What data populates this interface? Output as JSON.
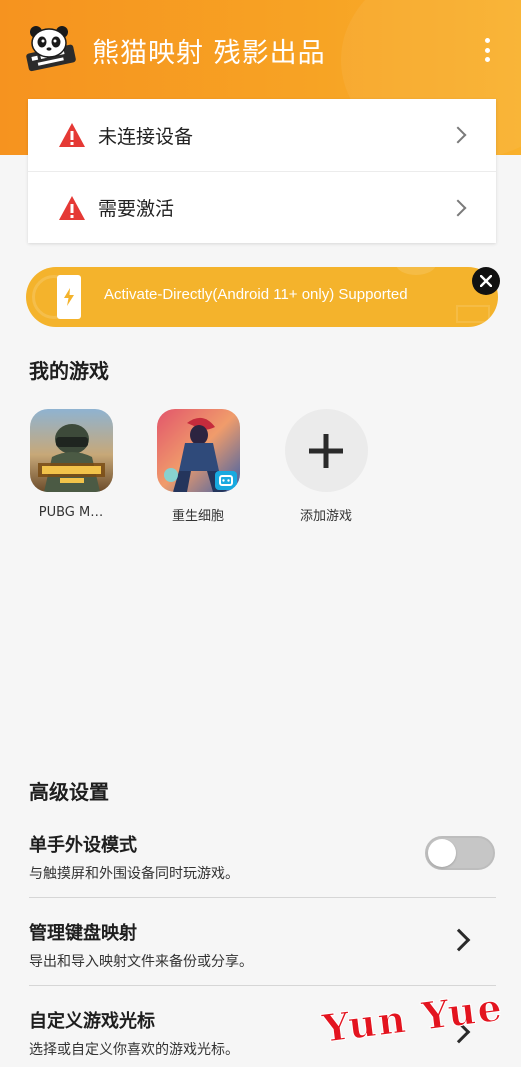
{
  "header": {
    "title": "熊猫映射 残影出品",
    "logo_icon": "panda-keyboard-logo-icon",
    "menu_icon": "more-vertical-icon",
    "colors": {
      "gradient_start": "#f6931f",
      "gradient_end": "#f9b12c"
    }
  },
  "status": {
    "items": [
      {
        "label": "未连接设备",
        "icon": "warning-icon"
      },
      {
        "label": "需要激活",
        "icon": "warning-icon"
      }
    ],
    "warning_color": "#e53935"
  },
  "banner": {
    "text": "Activate-Directly(Android 11+ only) Supported",
    "icon": "phone-bolt-icon",
    "close_icon": "close-icon",
    "color": "#f4b32c"
  },
  "my_games": {
    "title": "我的游戏",
    "games": [
      {
        "label": "PUBG M…",
        "icon": "pubg-game-icon"
      },
      {
        "label": "重生细胞",
        "icon": "dead-cells-game-icon"
      }
    ],
    "add_label": "添加游戏",
    "add_icon": "plus-icon"
  },
  "advanced": {
    "title": "高级设置",
    "items": [
      {
        "title": "单手外设模式",
        "desc": "与触摸屏和外围设备同时玩游戏。",
        "control": "toggle",
        "on": false
      },
      {
        "title": "管理键盘映射",
        "desc": "导出和导入映射文件来备份或分享。",
        "control": "chevron"
      },
      {
        "title": "自定义游戏光标",
        "desc": "选择或自定义你喜欢的游戏光标。",
        "control": "chevron"
      }
    ]
  },
  "watermark": {
    "text": "Yun Yue"
  }
}
